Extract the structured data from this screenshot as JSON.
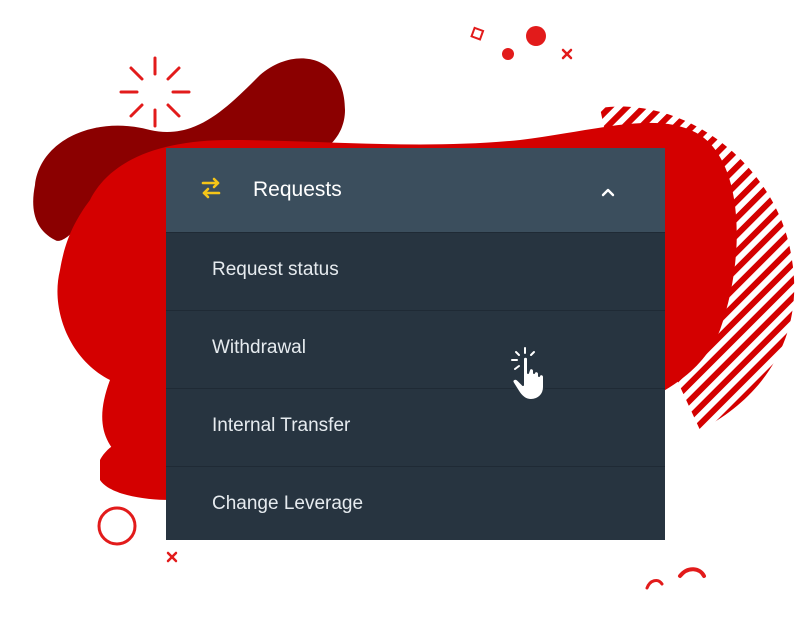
{
  "menu": {
    "header_label": "Requests",
    "header_icon": "swap-arrows-icon",
    "toggle_icon": "chevron-up-icon",
    "accent_color": "#f5c518",
    "items": [
      {
        "label": "Request status"
      },
      {
        "label": "Withdrawal"
      },
      {
        "label": "Internal Transfer"
      },
      {
        "label": "Change Leverage"
      }
    ]
  },
  "pointer": {
    "icon": "pointing-hand-cursor-icon"
  },
  "colors": {
    "brand_red": "#d40000",
    "dark_red": "#8b0000",
    "header_bg": "#3b4e5d",
    "panel_bg": "#273440"
  }
}
